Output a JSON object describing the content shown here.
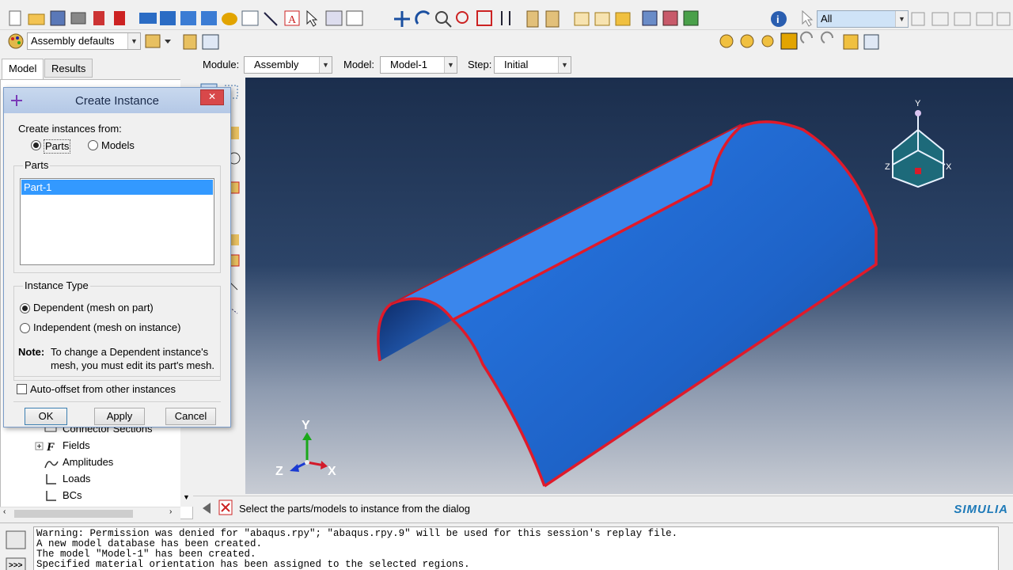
{
  "toolbar": {
    "render_style": "Assembly defaults",
    "selection_filter": "All",
    "icons": [
      "new-icon",
      "open-icon",
      "save-icon",
      "print-icon",
      "red-stack-icon",
      "red-stack2-icon",
      "viewport-icon",
      "tile-icon",
      "cascade-icon",
      "view-icon",
      "table-icon",
      "magnify-icon",
      "arrow-icon",
      "text-icon",
      "select-icon",
      "options-icon",
      "dots-icon",
      "pan-icon",
      "rotate-icon",
      "zoom-icon",
      "box-zoom-icon",
      "auto-fit-icon",
      "cycle-icon",
      "ladder-icon",
      "ladder2-icon",
      "iso-view-icon",
      "front-view-icon",
      "side-view-icon",
      "render-wire-icon",
      "render-hidden-icon",
      "render-shaded-icon",
      "info-icon",
      "pointer-icon"
    ]
  },
  "tabs": {
    "model": "Model",
    "results": "Results"
  },
  "context": {
    "module_label": "Module:",
    "module_value": "Assembly",
    "model_label": "Model:",
    "model_value": "Model-1",
    "step_label": "Step:",
    "step_value": "Initial"
  },
  "tree": {
    "items": [
      {
        "label": "Connector Sections",
        "icon": "connector-icon"
      },
      {
        "label": "Fields",
        "icon": "field-icon"
      },
      {
        "label": "Amplitudes",
        "icon": "amplitude-icon"
      },
      {
        "label": "Loads",
        "icon": "load-icon"
      },
      {
        "label": "BCs",
        "icon": "bc-icon"
      }
    ]
  },
  "dialog": {
    "title": "Create Instance",
    "create_from_label": "Create instances from:",
    "option_parts": "Parts",
    "option_models": "Models",
    "parts_group": "Parts",
    "parts_list": [
      "Part-1"
    ],
    "instance_type_group": "Instance Type",
    "dependent": "Dependent (mesh on part)",
    "independent": "Independent (mesh on instance)",
    "note_label": "Note:",
    "note_line1": "To change a Dependent instance's",
    "note_line2": "mesh, you must edit its part's mesh.",
    "auto_offset": "Auto-offset from other instances",
    "ok": "OK",
    "apply": "Apply",
    "cancel": "Cancel"
  },
  "prompt": {
    "text": "Select the parts/models to instance from the dialog",
    "brand": "SIMULIA"
  },
  "triad": {
    "y": "Y",
    "z": "Z",
    "x": "X"
  },
  "messages": [
    "Warning: Permission was denied for \"abaqus.rpy\"; \"abaqus.rpy.9\" will be used for this session's replay file.",
    "A new model database has been created.",
    "The model \"Model-1\" has been created.",
    "Specified material orientation has been assigned to the selected regions."
  ],
  "colors": {
    "part_fill": "#1f6fd6",
    "edge": "#e01a2a",
    "viewport_top": "#1b2e4d"
  }
}
